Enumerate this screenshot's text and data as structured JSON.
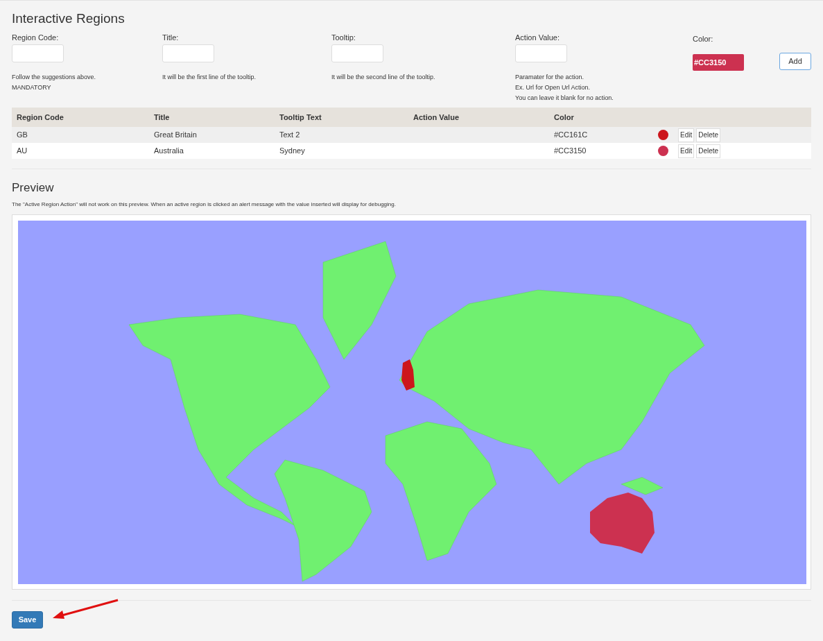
{
  "form": {
    "title": "Interactive Regions",
    "fields": [
      {
        "label": "Region Code:",
        "hints": [
          "Follow the suggestions above.",
          "MANDATORY"
        ]
      },
      {
        "label": "Title:",
        "hints": [
          "It will be the first line of the tooltip."
        ]
      },
      {
        "label": "Tooltip:",
        "hints": [
          "It will be the second line of the tooltip."
        ]
      },
      {
        "label": "Action Value:",
        "hints": [
          "Paramater for the action.",
          "Ex. Url for Open Url Action.",
          "You can leave it blank for no action."
        ]
      }
    ],
    "color": {
      "label": "Color:",
      "value": "#CC3150"
    },
    "add_button": "Add"
  },
  "table": {
    "columns": [
      "Region Code",
      "Title",
      "Tooltip Text",
      "Action Value",
      "Color"
    ],
    "rows": [
      {
        "region_code": "GB",
        "title": "Great Britain",
        "tooltip": "Text 2",
        "color_text": "#CC161C",
        "color": "#cc161c",
        "edit": "Edit",
        "delete": "Delete"
      },
      {
        "region_code": "AU",
        "title": "Australia",
        "tooltip": "Sydney",
        "color_text": "#CC3150",
        "color": "#cc3150",
        "edit": "Edit",
        "delete": "Delete"
      }
    ]
  },
  "preview": {
    "title": "Preview",
    "note": "The \"Active Region Action\" will not work on this preview. When an active region is clicked an alert message with the value inserted will display for debugging."
  },
  "save_button": "Save"
}
